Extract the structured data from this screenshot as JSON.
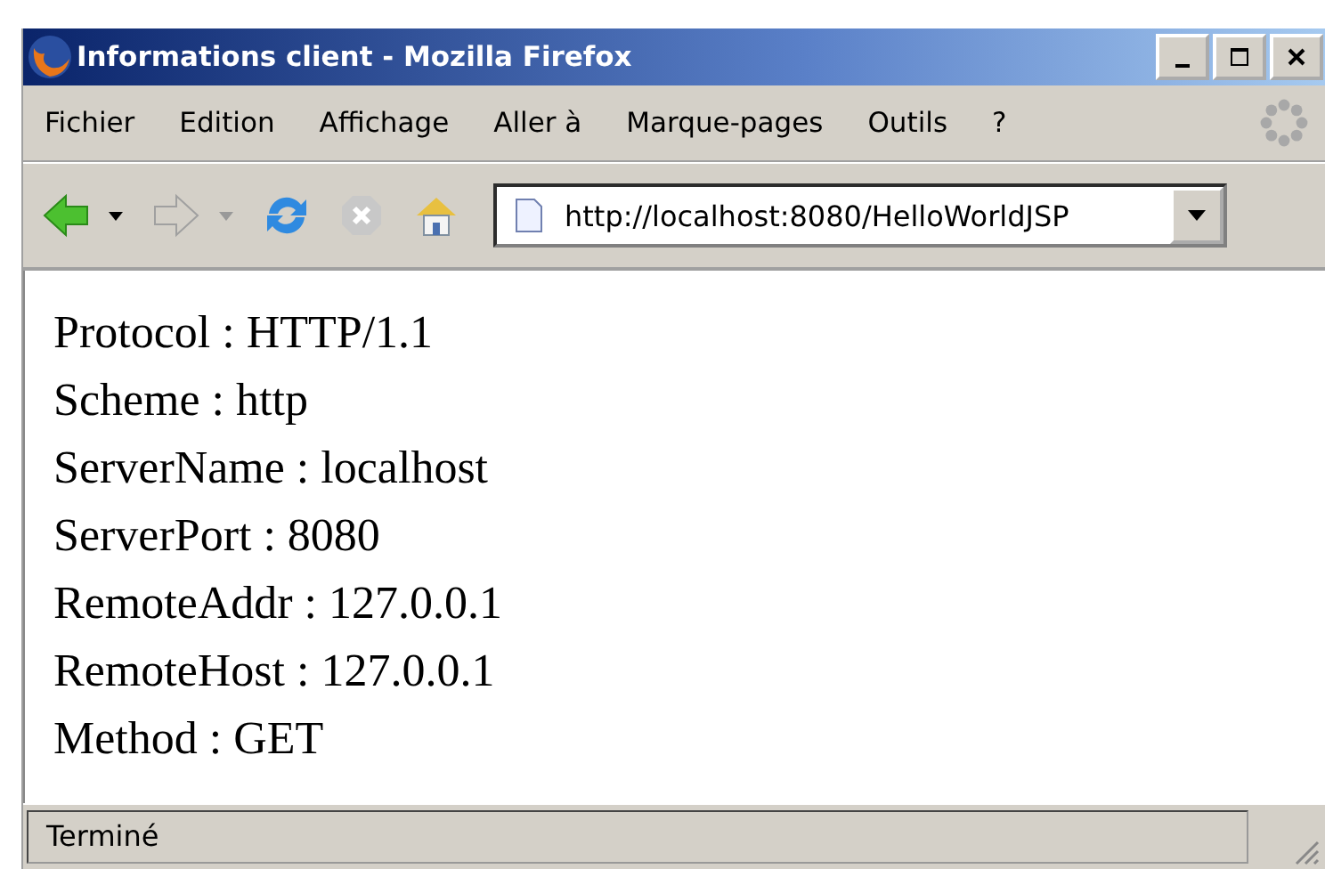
{
  "window": {
    "title": "Informations client - Mozilla Firefox"
  },
  "menu": [
    "Fichier",
    "Edition",
    "Affichage",
    "Aller à",
    "Marque-pages",
    "Outils",
    "?"
  ],
  "toolbar": {
    "back_enabled": true,
    "forward_enabled": false,
    "stop_enabled": false,
    "url": "http://localhost:8080/HelloWorldJSP"
  },
  "content": [
    "Protocol : HTTP/1.1",
    "Scheme : http",
    "ServerName : localhost",
    "ServerPort : 8080",
    "RemoteAddr : 127.0.0.1",
    "RemoteHost : 127.0.0.1",
    "Method : GET"
  ],
  "status_bar": "Terminé"
}
